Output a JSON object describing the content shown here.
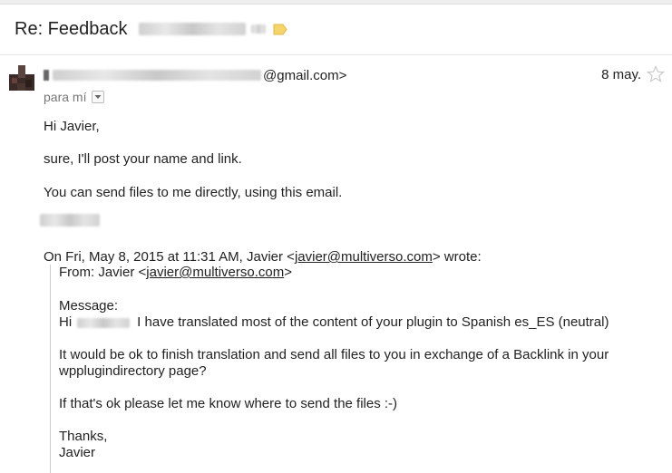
{
  "email": {
    "subject": "Re: Feedback",
    "sender_email_suffix": "@gmail.com>",
    "date": "8 may.",
    "recipient": "para mí",
    "body": {
      "greeting": "Hi Javier,",
      "line1": "sure, I'll post your name and link.",
      "line2": "You can send files to me directly, using this email."
    },
    "quote": {
      "header_prefix": "On Fri, May 8, 2015 at 11:31 AM, Javier <",
      "header_email": "javier@multiverso.com",
      "header_suffix": "> wrote:",
      "from_prefix": "From: Javier <",
      "from_email": "javier@multiverso.com",
      "from_suffix": ">",
      "message_label": "Message:",
      "hi": "Hi",
      "line1": "I have translated most of the content of your plugin to Spanish es_ES (neutral)",
      "line2a": "It would be ok to finish translation and send all files to you in exchange of a Backlink in your",
      "line2b": "wpplugindirectory page?",
      "line3": "If that's ok please let me know where to send the files :-)",
      "thanks": "Thanks,",
      "signature": "Javier"
    }
  },
  "colors": {
    "label_tag": "#f5d46b",
    "star_outline": "#c8c8c8",
    "text": "#222222",
    "muted": "#777777"
  },
  "icons": {
    "label": "label-tag-icon",
    "star": "star-icon",
    "dropdown": "chevron-down-icon",
    "avatar": "avatar"
  }
}
